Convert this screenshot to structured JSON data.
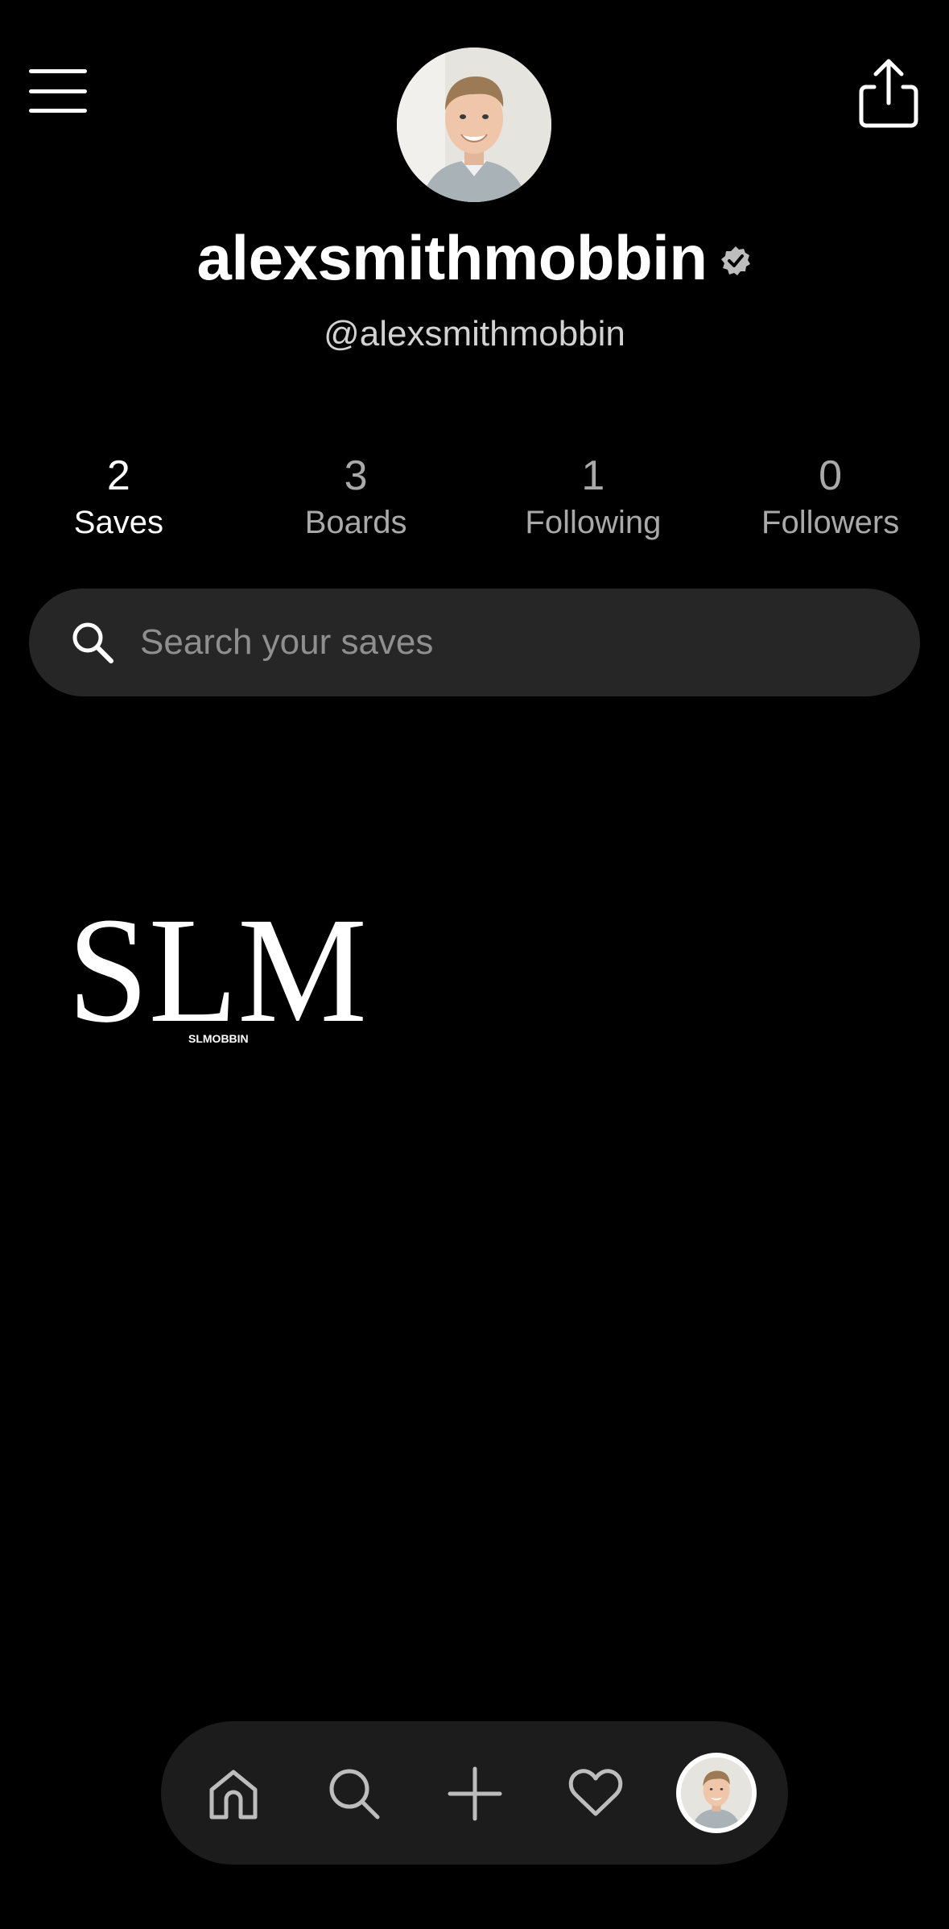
{
  "header": {
    "menu_icon": "hamburger-menu-icon",
    "share_icon": "share-icon",
    "avatar_alt": "profile photo"
  },
  "profile": {
    "display_name": "alexsmithmobbin",
    "verified_icon": "verified-badge-icon",
    "handle": "@alexsmithmobbin"
  },
  "stats": [
    {
      "value": "2",
      "label": "Saves",
      "active": true
    },
    {
      "value": "3",
      "label": "Boards",
      "active": false
    },
    {
      "value": "1",
      "label": "Following",
      "active": false
    },
    {
      "value": "0",
      "label": "Followers",
      "active": false
    }
  ],
  "search": {
    "placeholder": "Search your saves",
    "icon": "search-icon"
  },
  "saved_item": {
    "logo_text": "SLM",
    "logo_subtext": "SLMOBBIN"
  },
  "bottom_nav": {
    "items": [
      "home-icon",
      "search-icon",
      "plus-icon",
      "heart-icon",
      "profile-avatar"
    ]
  },
  "colors": {
    "background": "#000000",
    "search_bg": "#262626",
    "nav_bg": "#1c1c1c",
    "muted_text": "#a9a9a9",
    "placeholder": "#8f8f8f"
  }
}
